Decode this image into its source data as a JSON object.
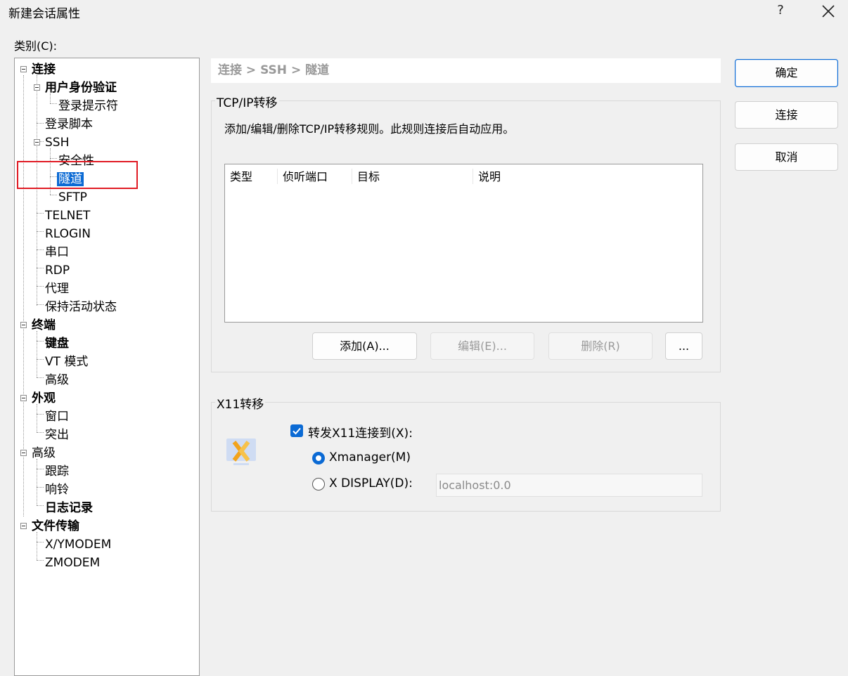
{
  "window": {
    "title": "新建会话属性",
    "help": "?"
  },
  "category_label": "类别(C):",
  "tree": [
    {
      "label": "连接",
      "bold": true
    },
    {
      "label": "用户身份验证",
      "bold": true
    },
    {
      "label": "登录提示符"
    },
    {
      "label": "登录脚本"
    },
    {
      "label": "SSH"
    },
    {
      "label": "安全性"
    },
    {
      "label": "隧道",
      "selected": true
    },
    {
      "label": "SFTP"
    },
    {
      "label": "TELNET"
    },
    {
      "label": "RLOGIN"
    },
    {
      "label": "串口"
    },
    {
      "label": "RDP"
    },
    {
      "label": "代理"
    },
    {
      "label": "保持活动状态"
    },
    {
      "label": "终端",
      "bold": true
    },
    {
      "label": "键盘",
      "bold": true
    },
    {
      "label": "VT 模式"
    },
    {
      "label": "高级"
    },
    {
      "label": "外观",
      "bold": true
    },
    {
      "label": "窗口"
    },
    {
      "label": "突出"
    },
    {
      "label": "高级"
    },
    {
      "label": "跟踪"
    },
    {
      "label": "响铃"
    },
    {
      "label": "日志记录",
      "bold": true
    },
    {
      "label": "文件传输",
      "bold": true
    },
    {
      "label": "X/YMODEM"
    },
    {
      "label": "ZMODEM"
    }
  ],
  "breadcrumb": "连接 > SSH > 隧道",
  "tcp": {
    "title": "TCP/IP转移",
    "description": "添加/编辑/删除TCP/IP转移规则。此规则连接后自动应用。",
    "columns": [
      "类型",
      "侦听端口",
      "目标",
      "说明"
    ],
    "buttons": {
      "add": "添加(A)...",
      "edit": "编辑(E)...",
      "delete": "删除(R)",
      "more": "..."
    }
  },
  "x11": {
    "title": "X11转移",
    "forward_checkbox": {
      "label": "转发X11连接到(X):",
      "checked": true
    },
    "radio_xmanager": {
      "label": "Xmanager(M)",
      "selected": true
    },
    "radio_display": {
      "label": "X DISPLAY(D):",
      "selected": false
    },
    "display_value": "localhost:0.0"
  },
  "actions": {
    "ok": "确定",
    "connect": "连接",
    "cancel": "取消"
  },
  "colors": {
    "accent": "#0b6ad4",
    "highlight_box": "#e01b24"
  }
}
